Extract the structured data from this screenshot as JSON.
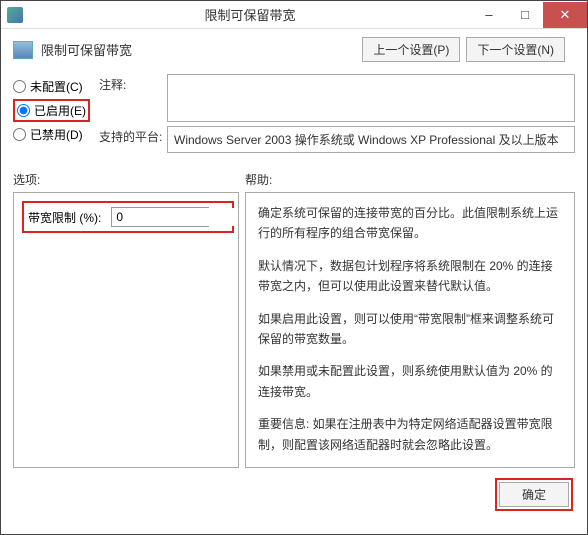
{
  "window": {
    "title": "限制可保留带宽"
  },
  "header": {
    "title": "限制可保留带宽",
    "prev": "上一个设置(P)",
    "next": "下一个设置(N)"
  },
  "radios": {
    "not_configured": "未配置(C)",
    "enabled": "已启用(E)",
    "disabled": "已禁用(D)"
  },
  "labels": {
    "comment": "注释:",
    "platform": "支持的平台:",
    "options": "选项:",
    "help": "帮助:"
  },
  "platform_text": "Windows Server 2003 操作系统或 Windows XP Professional 及以上版本",
  "option": {
    "label": "带宽限制 (%):",
    "value": "0"
  },
  "help": {
    "p1": "确定系统可保留的连接带宽的百分比。此值限制系统上运行的所有程序的组合带宽保留。",
    "p2": "默认情况下，数据包计划程序将系统限制在 20% 的连接带宽之内，但可以使用此设置来替代默认值。",
    "p3": "如果启用此设置，则可以使用“带宽限制”框来调整系统可保留的带宽数量。",
    "p4": "如果禁用或未配置此设置，则系统使用默认值为 20% 的连接带宽。",
    "p5": "重要信息: 如果在注册表中为特定网络适配器设置带宽限制，则配置该网络适配器时就会忽略此设置。"
  },
  "footer": {
    "ok": "确定"
  }
}
